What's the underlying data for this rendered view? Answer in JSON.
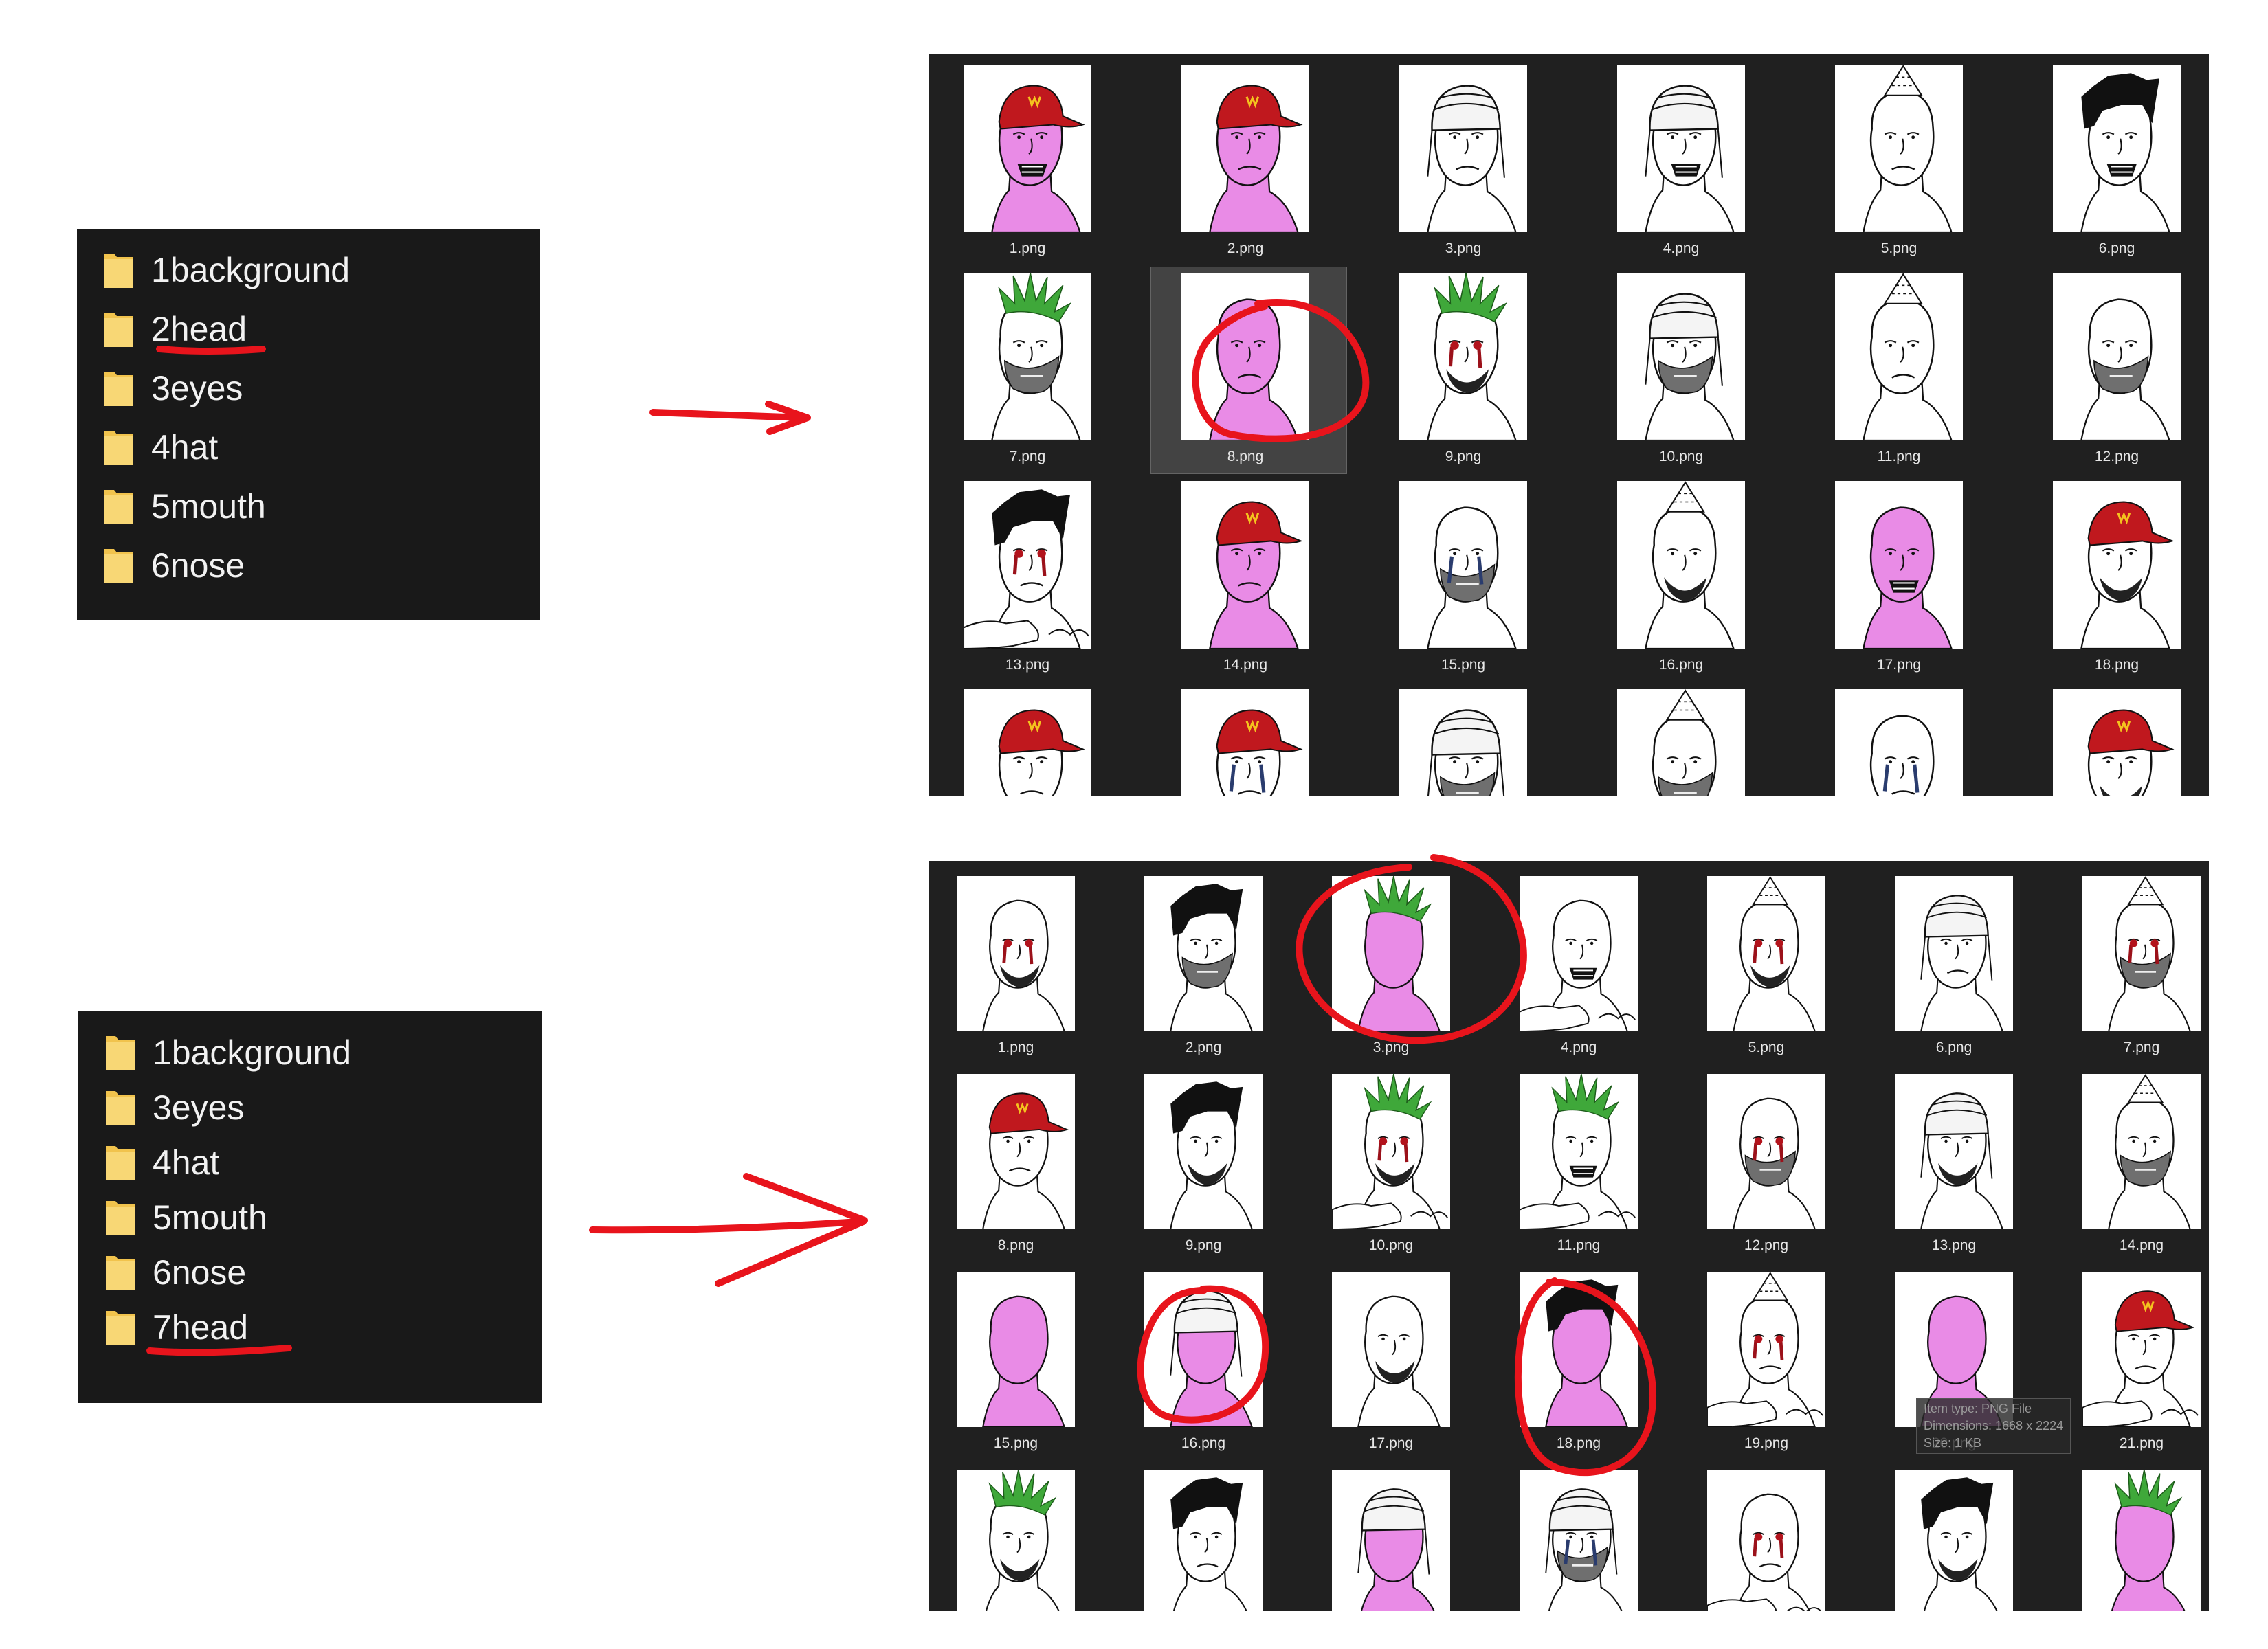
{
  "top": {
    "folders": [
      "1background",
      "2head",
      "3eyes",
      "4hat",
      "5mouth",
      "6nose"
    ],
    "thumbs": [
      {
        "label": "1.png",
        "skin": "pink",
        "hat": "cap",
        "mouth": "teeth"
      },
      {
        "label": "2.png",
        "skin": "pink",
        "hat": "cap",
        "mouth": "frown"
      },
      {
        "label": "3.png",
        "skin": "white",
        "hat": "helmet",
        "mouth": "frown"
      },
      {
        "label": "4.png",
        "skin": "white",
        "hat": "helmet",
        "mouth": "teeth"
      },
      {
        "label": "5.png",
        "skin": "white",
        "hat": "party",
        "mouth": "frown"
      },
      {
        "label": "6.png",
        "skin": "white",
        "hat": "hair",
        "mouth": "teeth"
      },
      {
        "label": "7.png",
        "skin": "white",
        "hat": "mohawk",
        "mouth": "gray"
      },
      {
        "label": "8.png",
        "skin": "pink",
        "hat": "none",
        "mouth": "frown"
      },
      {
        "label": "9.png",
        "skin": "white",
        "hat": "mohawk",
        "mouth": "beard",
        "tears": "blood"
      },
      {
        "label": "10.png",
        "skin": "white",
        "hat": "helmet",
        "mouth": "gray"
      },
      {
        "label": "11.png",
        "skin": "white",
        "hat": "party",
        "mouth": "frown"
      },
      {
        "label": "12.png",
        "skin": "white",
        "hat": "none",
        "mouth": "gray"
      },
      {
        "label": "13.png",
        "skin": "white",
        "hat": "hair",
        "mouth": "frown",
        "tears": "blood",
        "arms": true
      },
      {
        "label": "14.png",
        "skin": "pink",
        "hat": "cap",
        "mouth": "frown"
      },
      {
        "label": "15.png",
        "skin": "white",
        "hat": "none",
        "mouth": "gray",
        "tears": "blue"
      },
      {
        "label": "16.png",
        "skin": "white",
        "hat": "party",
        "mouth": "beard"
      },
      {
        "label": "17.png",
        "skin": "pink",
        "hat": "none",
        "mouth": "teeth"
      },
      {
        "label": "18.png",
        "skin": "white",
        "hat": "cap",
        "mouth": "beard"
      },
      {
        "label": "",
        "skin": "white",
        "hat": "cap",
        "mouth": "frown",
        "arms": true
      },
      {
        "label": "",
        "skin": "white",
        "hat": "cap",
        "mouth": "frown",
        "tears": "blue"
      },
      {
        "label": "",
        "skin": "white",
        "hat": "helmet",
        "mouth": "gray"
      },
      {
        "label": "",
        "skin": "white",
        "hat": "party",
        "mouth": "gray"
      },
      {
        "label": "",
        "skin": "white",
        "hat": "none",
        "mouth": "frown",
        "tears": "blue",
        "arms": true
      },
      {
        "label": "",
        "skin": "white",
        "hat": "cap",
        "mouth": "beard"
      }
    ]
  },
  "bottom": {
    "folders": [
      "1background",
      "3eyes",
      "4hat",
      "5mouth",
      "6nose",
      "7head"
    ],
    "thumbs": [
      {
        "label": "1.png",
        "skin": "white",
        "hat": "none",
        "mouth": "beard",
        "tears": "blood"
      },
      {
        "label": "2.png",
        "skin": "white",
        "hat": "hair",
        "mouth": "gray"
      },
      {
        "label": "3.png",
        "skin": "pink",
        "hat": "mohawk",
        "mouth": "none",
        "faceless": true
      },
      {
        "label": "4.png",
        "skin": "white",
        "hat": "none",
        "mouth": "teeth",
        "arms": true
      },
      {
        "label": "5.png",
        "skin": "white",
        "hat": "party",
        "mouth": "beard",
        "tears": "blood"
      },
      {
        "label": "6.png",
        "skin": "white",
        "hat": "helmet",
        "mouth": "frown"
      },
      {
        "label": "7.png",
        "skin": "white",
        "hat": "party",
        "mouth": "gray",
        "tears": "blood"
      },
      {
        "label": "8.png",
        "skin": "white",
        "hat": "cap",
        "mouth": "frown"
      },
      {
        "label": "9.png",
        "skin": "white",
        "hat": "hair",
        "mouth": "beard"
      },
      {
        "label": "10.png",
        "skin": "white",
        "hat": "mohawk",
        "mouth": "beard",
        "tears": "blood",
        "arms": true
      },
      {
        "label": "11.png",
        "skin": "white",
        "hat": "mohawk",
        "mouth": "teeth",
        "arms": true
      },
      {
        "label": "12.png",
        "skin": "white",
        "hat": "none",
        "mouth": "gray",
        "tears": "blood"
      },
      {
        "label": "13.png",
        "skin": "white",
        "hat": "helmet",
        "mouth": "beard"
      },
      {
        "label": "14.png",
        "skin": "white",
        "hat": "party",
        "mouth": "gray"
      },
      {
        "label": "15.png",
        "skin": "pink",
        "hat": "none",
        "mouth": "none",
        "faceless": true
      },
      {
        "label": "16.png",
        "skin": "pink",
        "hat": "helmet",
        "mouth": "none",
        "faceless": true
      },
      {
        "label": "17.png",
        "skin": "white",
        "hat": "none",
        "mouth": "beard"
      },
      {
        "label": "18.png",
        "skin": "pink",
        "hat": "hair",
        "mouth": "none",
        "faceless": true
      },
      {
        "label": "19.png",
        "skin": "white",
        "hat": "party",
        "mouth": "frown",
        "tears": "blood",
        "arms": true
      },
      {
        "label": "20.png",
        "skin": "pink",
        "hat": "none",
        "mouth": "none",
        "faceless": true
      },
      {
        "label": "21.png",
        "skin": "white",
        "hat": "cap",
        "mouth": "frown",
        "arms": true
      },
      {
        "label": "",
        "skin": "white",
        "hat": "mohawk",
        "mouth": "beard"
      },
      {
        "label": "",
        "skin": "white",
        "hat": "hair",
        "mouth": "frown"
      },
      {
        "label": "",
        "skin": "pink",
        "hat": "helmet",
        "mouth": "none",
        "faceless": true
      },
      {
        "label": "",
        "skin": "white",
        "hat": "helmet",
        "mouth": "gray",
        "tears": "blue"
      },
      {
        "label": "",
        "skin": "white",
        "hat": "none",
        "mouth": "frown",
        "tears": "blood",
        "arms": true
      },
      {
        "label": "",
        "skin": "white",
        "hat": "hair",
        "mouth": "beard"
      },
      {
        "label": "",
        "skin": "pink",
        "hat": "mohawk",
        "mouth": "none",
        "faceless": true
      }
    ],
    "tooltip": {
      "item_type": "Item type: PNG File",
      "dimensions": "Dimensions: 1668 x 2224",
      "size": "Size: 1 KB"
    }
  },
  "colors": {
    "annotation_red": "#e8141c",
    "folder_yellow": "#f8d775",
    "pink_skin": "#e98be6",
    "cap_red": "#c0181e",
    "mohawk_green": "#3fa83a"
  }
}
